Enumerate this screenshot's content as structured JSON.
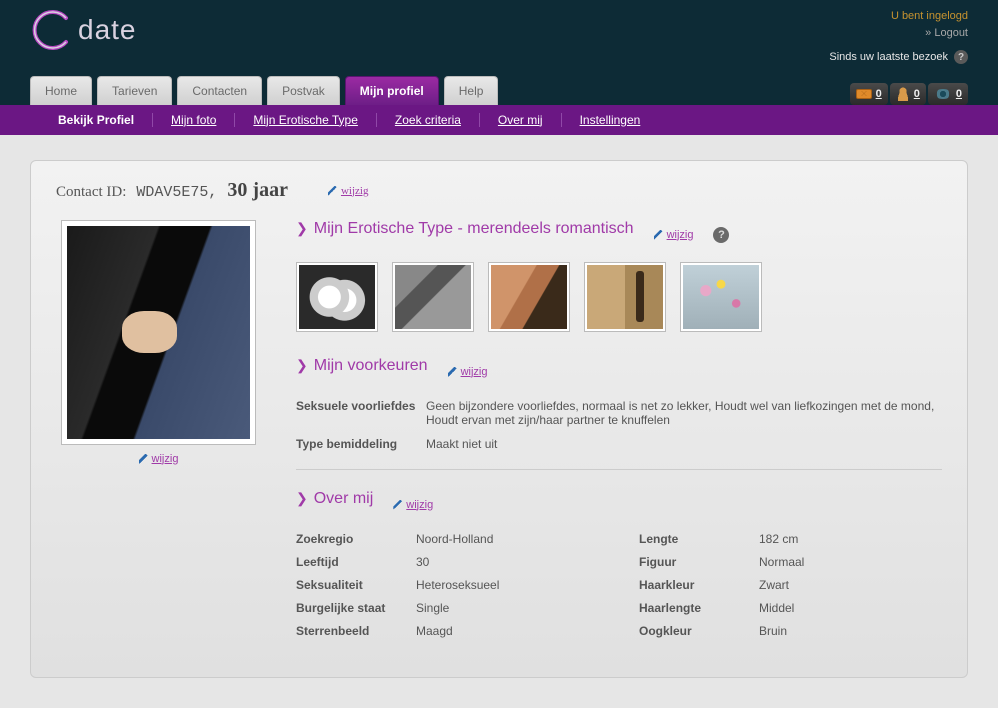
{
  "header": {
    "logo_text": "date",
    "logged_in": "U bent ingelogd",
    "logout": "» Logout",
    "since_visit": "Sinds uw laatste bezoek"
  },
  "counters": {
    "mail": "0",
    "contacts": "0",
    "views": "0"
  },
  "tabs": [
    "Home",
    "Tarieven",
    "Contacten",
    "Postvak",
    "Mijn profiel",
    "Help"
  ],
  "subnav": [
    "Bekijk Profiel",
    "Mijn foto",
    "Mijn Erotische Type",
    "Zoek criteria",
    "Over mij",
    "Instellingen"
  ],
  "profile": {
    "contact_id_label": "Contact ID:",
    "contact_id": "WDAV5E75,",
    "age": "30 jaar",
    "wijzig": "wijzig"
  },
  "sect1": {
    "title": "Mijn Erotische Type - merendeels romantisch"
  },
  "sect2": {
    "title": "Mijn voorkeuren",
    "k1": "Seksuele voorliefdes",
    "v1": "Geen bijzondere voorliefdes, normaal is net zo lekker, Houdt wel van liefkozingen met de mond, Houdt ervan met zijn/haar partner te knuffelen",
    "k2": "Type bemiddeling",
    "v2": "Maakt niet uit"
  },
  "sect3": {
    "title": "Over mij",
    "left": [
      {
        "k": "Zoekregio",
        "v": "Noord-Holland"
      },
      {
        "k": "Leeftijd",
        "v": "30"
      },
      {
        "k": "Seksualiteit",
        "v": "Heteroseksueel"
      },
      {
        "k": "Burgelijke staat",
        "v": "Single"
      },
      {
        "k": "Sterrenbeeld",
        "v": "Maagd"
      }
    ],
    "right": [
      {
        "k": "Lengte",
        "v": "182 cm"
      },
      {
        "k": "Figuur",
        "v": "Normaal"
      },
      {
        "k": "Haarkleur",
        "v": "Zwart"
      },
      {
        "k": "Haarlengte",
        "v": "Middel"
      },
      {
        "k": "Oogkleur",
        "v": "Bruin"
      }
    ]
  }
}
